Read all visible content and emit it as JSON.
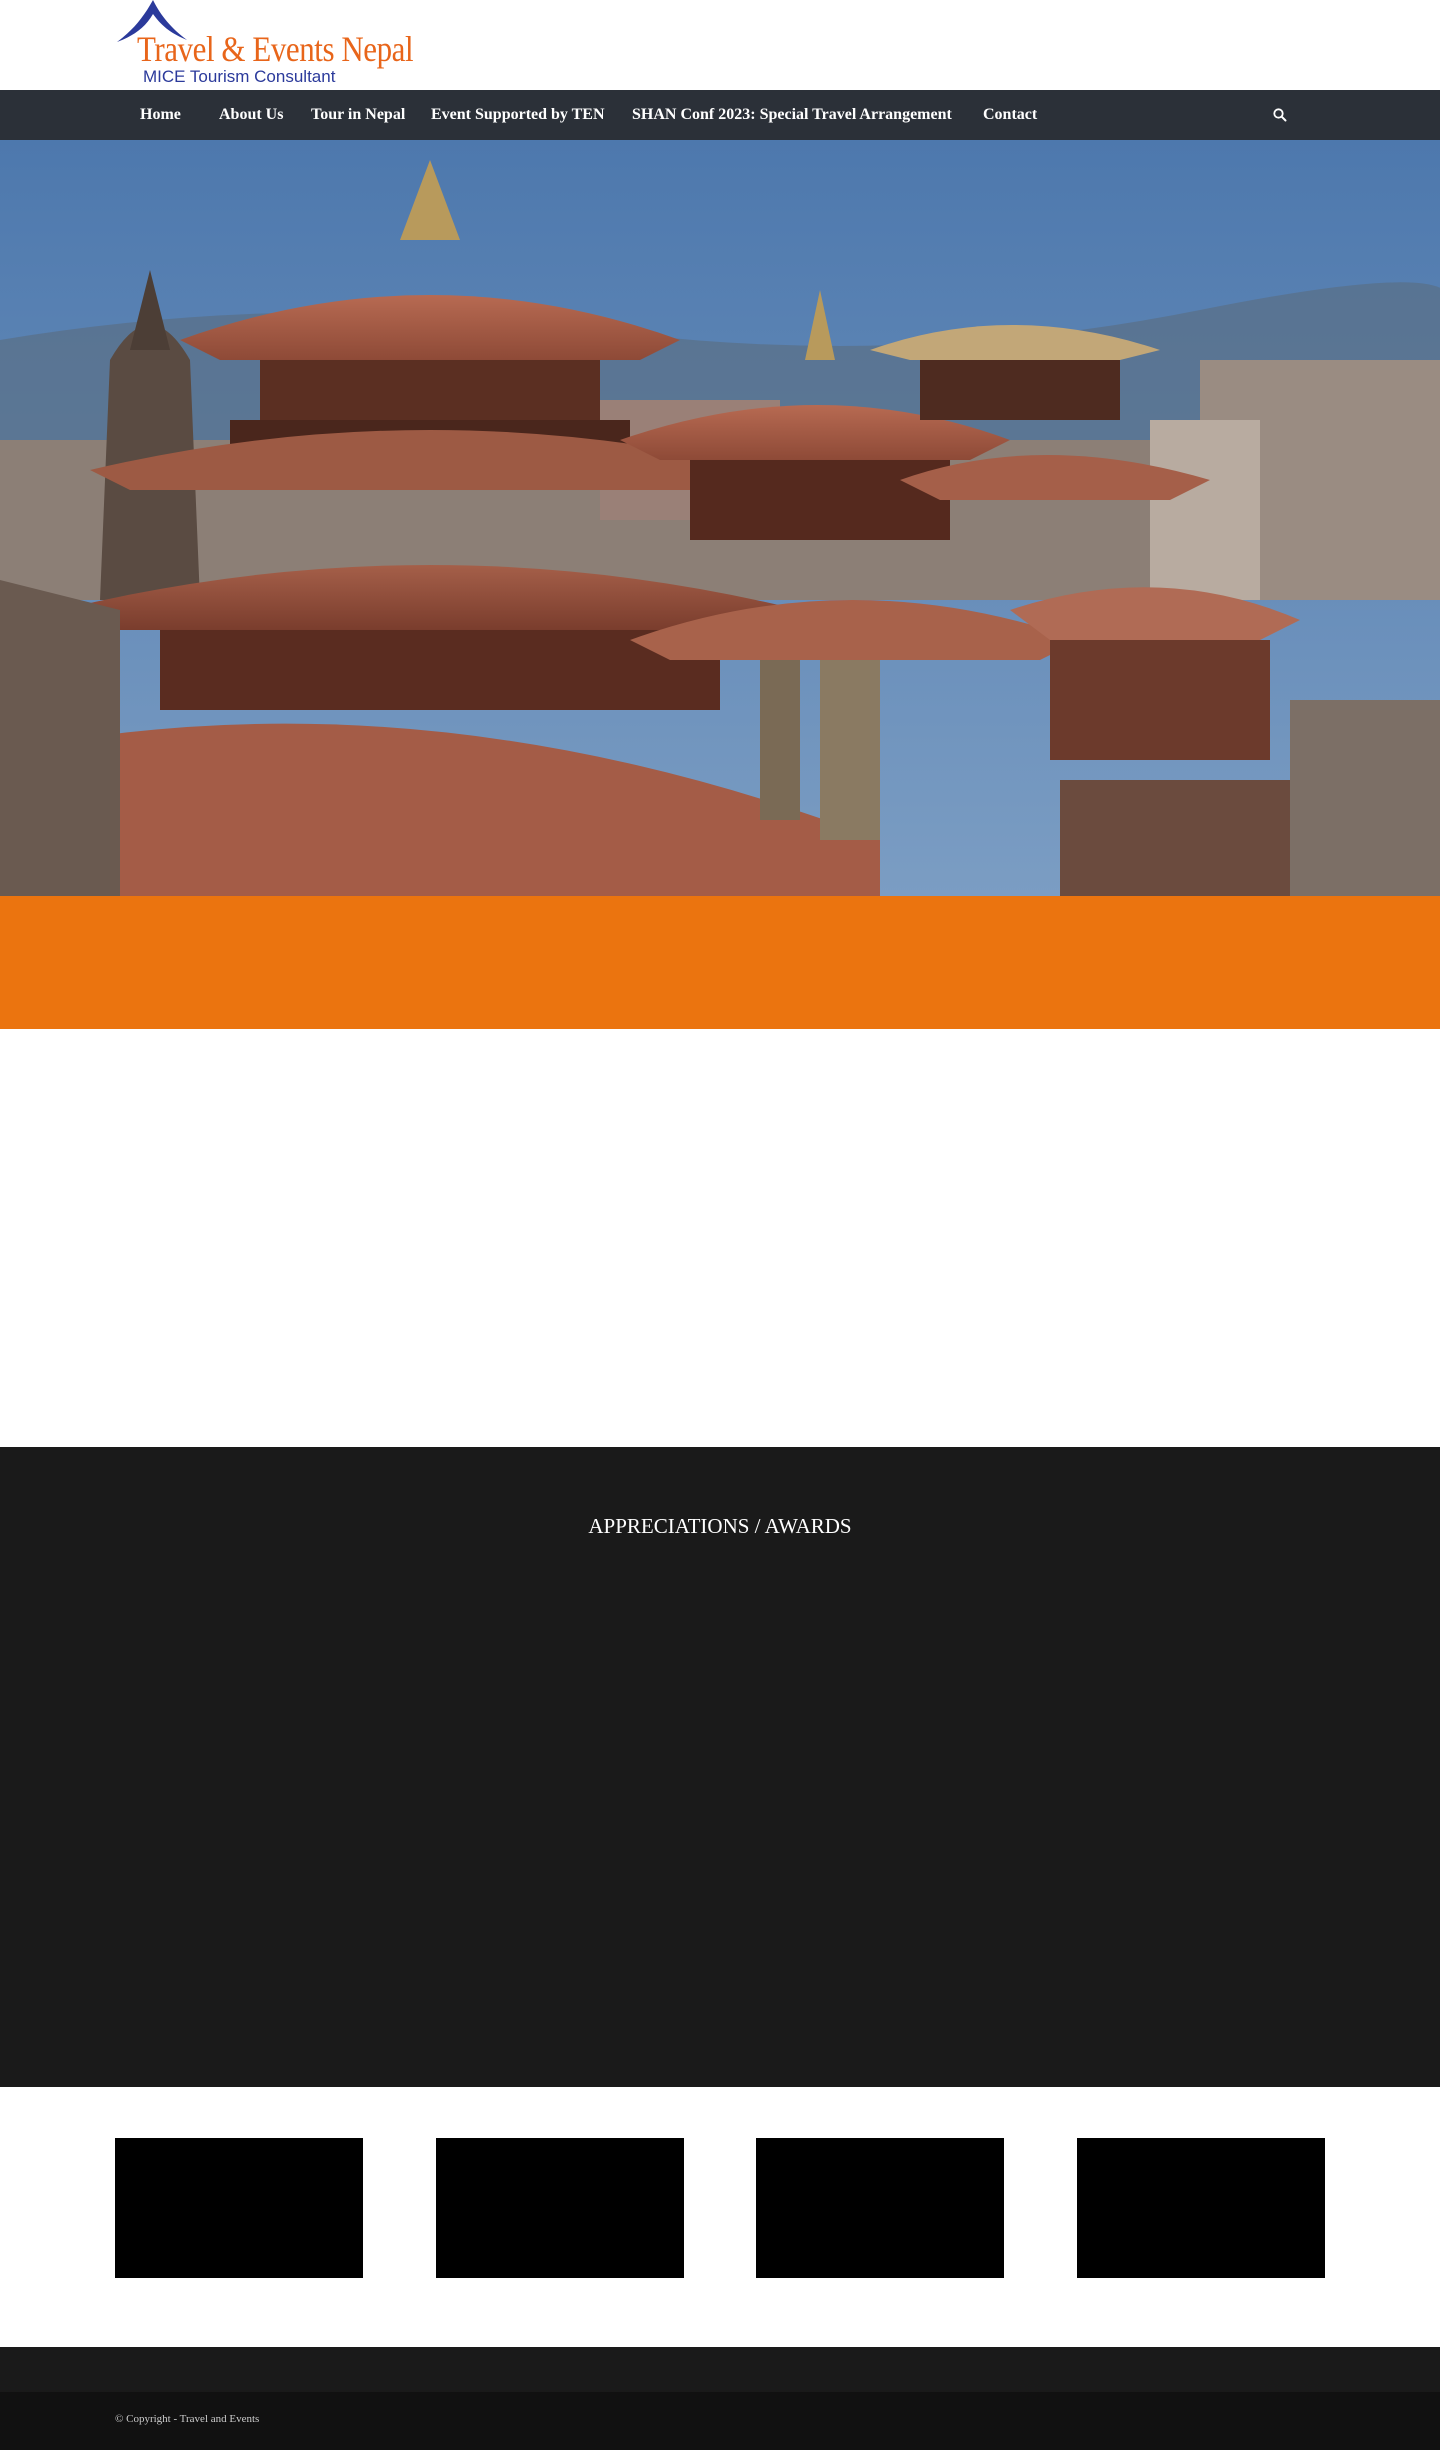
{
  "header": {
    "logo": {
      "title": "Travel & Events Nepal",
      "subtitle": "MICE Tourism Consultant",
      "icon": "tent-peak-logo-icon"
    }
  },
  "nav": {
    "items": [
      {
        "label": "Home"
      },
      {
        "label": "About Us"
      },
      {
        "label": "Tour in Nepal"
      },
      {
        "label": "Event Supported by TEN"
      },
      {
        "label": "SHAN Conf 2023: Special Travel Arrangement"
      },
      {
        "label": "Contact"
      }
    ],
    "search_icon": "search-icon"
  },
  "hero": {
    "image": "patan-durbar-square-pagoda-rooftops"
  },
  "awards": {
    "title": "APPRECIATIONS / AWARDS"
  },
  "footer": {
    "copyright": "© Copyright - Travel and Events"
  },
  "colors": {
    "nav_bg": "#2b3038",
    "accent_orange": "#eb740f",
    "dark_section": "#1a1a1a",
    "logo_orange": "#e8651a",
    "logo_blue": "#2b3a9b"
  }
}
